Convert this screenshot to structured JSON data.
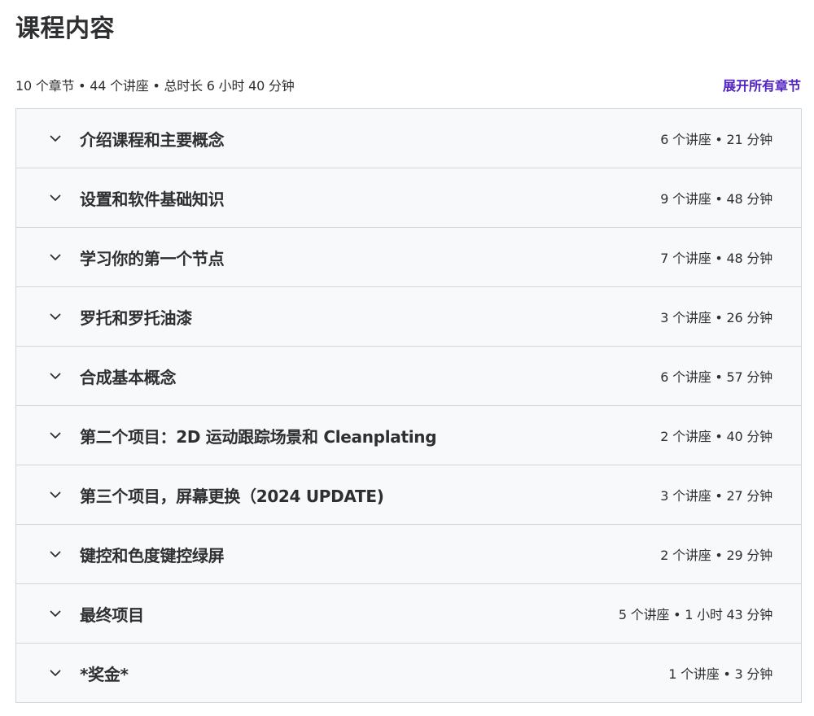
{
  "page": {
    "title": "课程内容"
  },
  "summary": {
    "text": "10 个章节 • 44 个讲座 • 总时长 6 小时 40 分钟",
    "expand_all_label": "展开所有章节"
  },
  "sections": [
    {
      "title": "介绍课程和主要概念",
      "meta": "6 个讲座 • 21 分钟",
      "icon": "chevron-down-icon"
    },
    {
      "title": "设置和软件基础知识",
      "meta": "9 个讲座 • 48 分钟",
      "icon": "chevron-down-icon"
    },
    {
      "title": "学习你的第一个节点",
      "meta": "7 个讲座 • 48 分钟",
      "icon": "chevron-down-icon"
    },
    {
      "title": "罗托和罗托油漆",
      "meta": "3 个讲座 • 26 分钟",
      "icon": "chevron-down-icon"
    },
    {
      "title": "合成基本概念",
      "meta": "6 个讲座 • 57 分钟",
      "icon": "chevron-down-icon"
    },
    {
      "title": "第二个项目：2D 运动跟踪场景和 Cleanplating",
      "meta": "2 个讲座 • 40 分钟",
      "icon": "chevron-down-icon"
    },
    {
      "title": "第三个项目，屏幕更换（2024 UPDATE)",
      "meta": "3 个讲座 • 27 分钟",
      "icon": "chevron-down-icon"
    },
    {
      "title": "键控和色度键控绿屏",
      "meta": "2 个讲座 • 29 分钟",
      "icon": "chevron-down-icon"
    },
    {
      "title": "最终项目",
      "meta": "5 个讲座 • 1 小时 43 分钟",
      "icon": "chevron-down-icon"
    },
    {
      "title": "*奖金*",
      "meta": "1 个讲座 • 3 分钟",
      "icon": "chevron-down-icon"
    }
  ],
  "colors": {
    "text": "#2d2f31",
    "link": "#5022c3",
    "section_bg": "#f7f9fa",
    "border": "#d1d7dc"
  }
}
